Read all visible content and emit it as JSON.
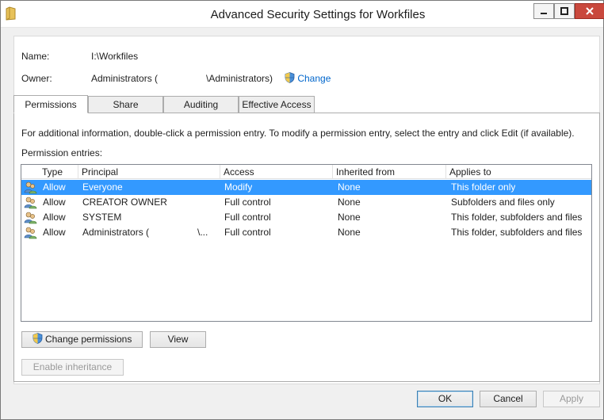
{
  "window": {
    "title": "Advanced Security Settings for Workfiles",
    "icon": "folder-icon",
    "controls": {
      "minimize": "minimize-icon",
      "maximize": "maximize-icon",
      "close": "close-icon"
    }
  },
  "object": {
    "name_label": "Name:",
    "name_value": "I:\\Workfiles",
    "owner_label": "Owner:",
    "owner_value_prefix": "Administrators (",
    "owner_value_suffix": "\\Administrators)",
    "owner_change": "Change"
  },
  "tabs": [
    {
      "label": "Permissions",
      "active": true
    },
    {
      "label": "Share",
      "active": false
    },
    {
      "label": "Auditing",
      "active": false
    },
    {
      "label": "Effective Access",
      "active": false
    }
  ],
  "permissions": {
    "info_text": "For additional information, double-click a permission entry. To modify a permission entry, select the entry and click Edit (if available).",
    "entries_label": "Permission entries:",
    "columns": [
      "Type",
      "Principal",
      "Access",
      "Inherited from",
      "Applies to"
    ],
    "rows": [
      {
        "type": "Allow",
        "principal": "Everyone",
        "access": "Modify",
        "inherited": "None",
        "applies": "This folder only",
        "selected": true
      },
      {
        "type": "Allow",
        "principal": "CREATOR OWNER",
        "access": "Full control",
        "inherited": "None",
        "applies": "Subfolders and files only",
        "selected": false
      },
      {
        "type": "Allow",
        "principal": "SYSTEM",
        "access": "Full control",
        "inherited": "None",
        "applies": "This folder, subfolders and files",
        "selected": false
      },
      {
        "type": "Allow",
        "principal_prefix": "Administrators (",
        "principal_suffix": "\\...",
        "access": "Full control",
        "inherited": "None",
        "applies": "This folder, subfolders and files",
        "selected": false
      }
    ],
    "change_permissions": "Change permissions",
    "view": "View",
    "enable_inheritance": "Enable inheritance"
  },
  "footer": {
    "ok": "OK",
    "cancel": "Cancel",
    "apply": "Apply"
  },
  "colors": {
    "selection": "#3399ff",
    "link": "#0066cc",
    "close_button": "#c9483d"
  }
}
